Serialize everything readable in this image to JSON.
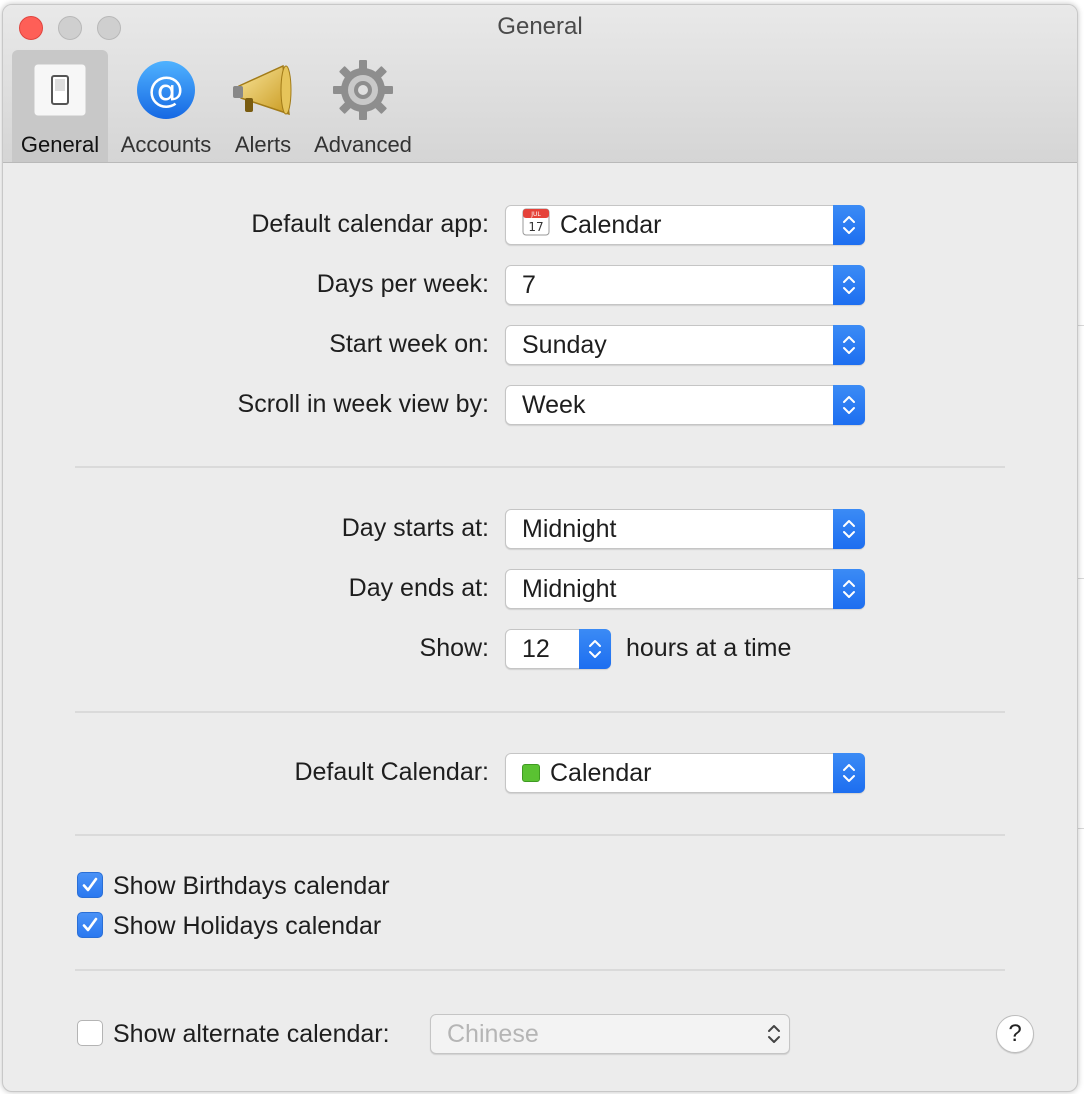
{
  "window": {
    "title": "General"
  },
  "toolbar": {
    "items": [
      {
        "label": "General",
        "icon": "light-switch-icon"
      },
      {
        "label": "Accounts",
        "icon": "at-sign-icon"
      },
      {
        "label": "Alerts",
        "icon": "megaphone-icon"
      },
      {
        "label": "Advanced",
        "icon": "gear-icon"
      }
    ]
  },
  "settings": {
    "default_calendar_app": {
      "label": "Default calendar app:",
      "value": "Calendar",
      "icon_month": "JUL",
      "icon_day": "17"
    },
    "days_per_week": {
      "label": "Days per week:",
      "value": "7"
    },
    "start_week_on": {
      "label": "Start week on:",
      "value": "Sunday"
    },
    "scroll_week_view": {
      "label": "Scroll in week view by:",
      "value": "Week"
    },
    "day_starts": {
      "label": "Day starts at:",
      "value": "Midnight"
    },
    "day_ends": {
      "label": "Day ends at:",
      "value": "Midnight"
    },
    "show_hours": {
      "label": "Show:",
      "value": "12",
      "suffix": "hours at a time"
    },
    "default_calendar": {
      "label": "Default Calendar:",
      "value": "Calendar",
      "color": "#5ac232"
    },
    "show_birthdays": {
      "label": "Show Birthdays calendar",
      "checked": true
    },
    "show_holidays": {
      "label": "Show Holidays calendar",
      "checked": true
    },
    "alternate_calendar": {
      "label": "Show alternate calendar:",
      "checked": false,
      "value": "Chinese"
    }
  },
  "help": {
    "label": "?"
  },
  "colors": {
    "accent": "#2a78f0",
    "close": "#fe5f57"
  }
}
